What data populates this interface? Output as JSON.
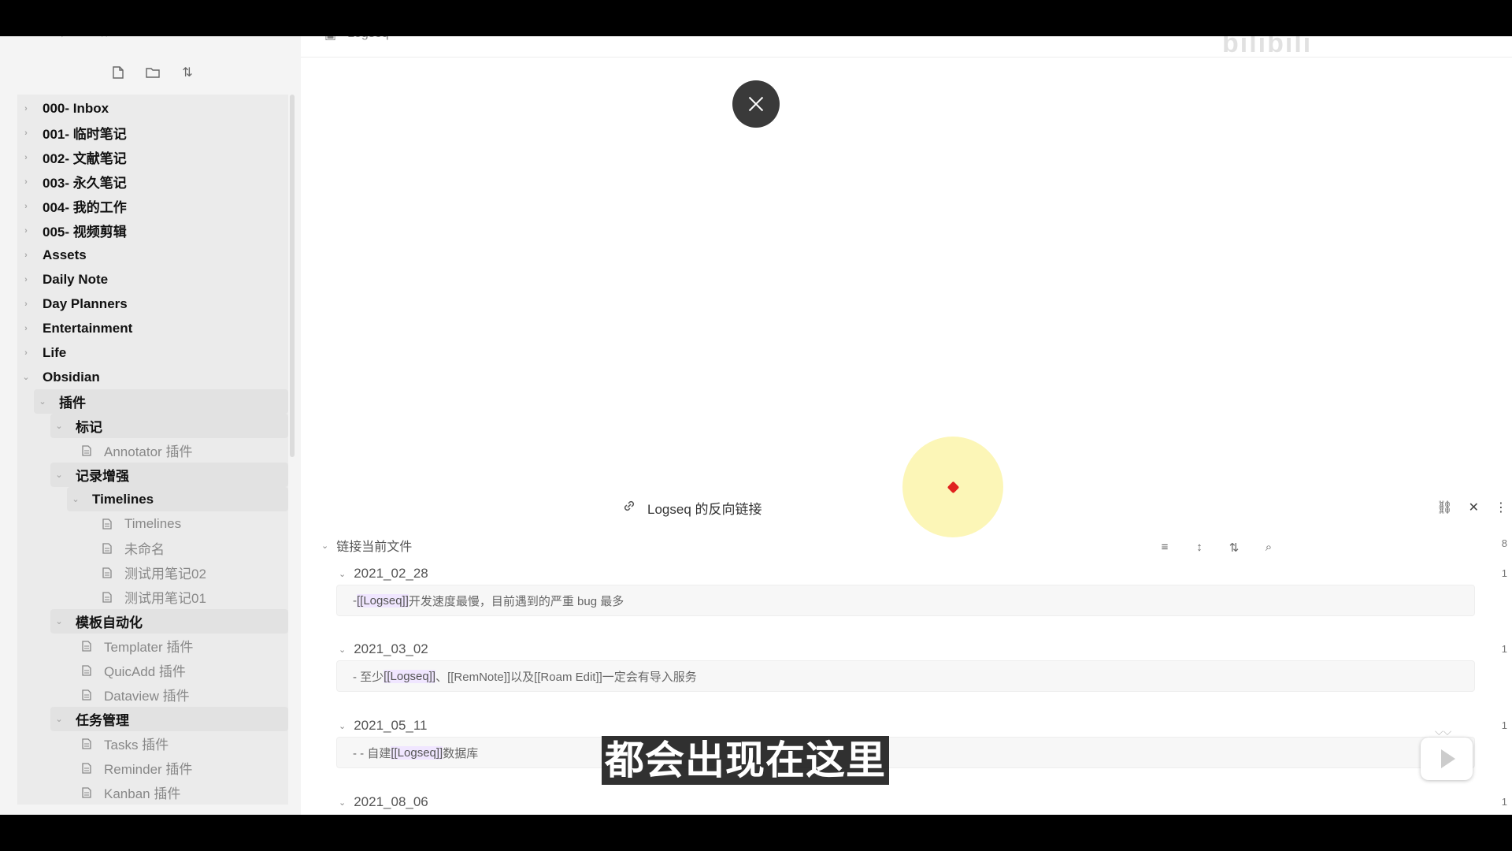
{
  "sidebar": {
    "toolbar": [
      "new-note-icon",
      "new-folder-icon",
      "sort-icon"
    ],
    "tree": [
      {
        "label": "000- Inbox",
        "type": "folder",
        "level": 0,
        "open": false
      },
      {
        "label": "001- 临时笔记",
        "type": "folder",
        "level": 0,
        "open": false
      },
      {
        "label": "002- 文献笔记",
        "type": "folder",
        "level": 0,
        "open": false
      },
      {
        "label": "003- 永久笔记",
        "type": "folder",
        "level": 0,
        "open": false
      },
      {
        "label": "004- 我的工作",
        "type": "folder",
        "level": 0,
        "open": false
      },
      {
        "label": "005- 视频剪辑",
        "type": "folder",
        "level": 0,
        "open": false
      },
      {
        "label": "Assets",
        "type": "folder",
        "level": 0,
        "open": false
      },
      {
        "label": "Daily Note",
        "type": "folder",
        "level": 0,
        "open": false
      },
      {
        "label": "Day Planners",
        "type": "folder",
        "level": 0,
        "open": false
      },
      {
        "label": "Entertainment",
        "type": "folder",
        "level": 0,
        "open": false
      },
      {
        "label": "Life",
        "type": "folder",
        "level": 0,
        "open": false
      },
      {
        "label": "Obsidian",
        "type": "folder",
        "level": 0,
        "open": true
      },
      {
        "label": "插件",
        "type": "folder",
        "level": 1,
        "open": true
      },
      {
        "label": "标记",
        "type": "folder",
        "level": 2,
        "open": true
      },
      {
        "label": "Annotator 插件",
        "type": "file",
        "level": 3
      },
      {
        "label": "记录增强",
        "type": "folder",
        "level": 2,
        "open": true
      },
      {
        "label": "Timelines",
        "type": "folder",
        "level": 3,
        "open": true
      },
      {
        "label": "Timelines",
        "type": "file",
        "level": 4
      },
      {
        "label": "未命名",
        "type": "file",
        "level": 4
      },
      {
        "label": "测试用笔记02",
        "type": "file",
        "level": 4
      },
      {
        "label": "测试用笔记01",
        "type": "file",
        "level": 4
      },
      {
        "label": "模板自动化",
        "type": "folder",
        "level": 2,
        "open": true
      },
      {
        "label": "Templater 插件",
        "type": "file",
        "level": 3
      },
      {
        "label": "QuicAdd 插件",
        "type": "file",
        "level": 3
      },
      {
        "label": "Dataview 插件",
        "type": "file",
        "level": 3
      },
      {
        "label": "任务管理",
        "type": "folder",
        "level": 2,
        "open": true
      },
      {
        "label": "Tasks 插件",
        "type": "file",
        "level": 3
      },
      {
        "label": "Reminder 插件",
        "type": "file",
        "level": 3
      },
      {
        "label": "Kanban 插件",
        "type": "file",
        "level": 3
      }
    ]
  },
  "main": {
    "tab_title": "Logseq",
    "watermark": "bilibili"
  },
  "backlinks": {
    "title": "Logseq 的反向链接",
    "group_label": "链接当前文件",
    "group_count": "8",
    "entries": [
      {
        "date": "2021_02_28",
        "count": "1",
        "prefix": "- ",
        "link": "[[Logseq]]",
        "text": " 开发速度最慢，目前遇到的严重 bug 最多"
      },
      {
        "date": "2021_03_02",
        "count": "1",
        "prefix": "- 至少 ",
        "link": "[[Logseq]]",
        "text": "、[[RemNote]]以及[[Roam Edit]]一定会有导入服务"
      },
      {
        "date": "2021_05_11",
        "count": "1",
        "prefix": "- - 自建 ",
        "link": "[[Logseq]]",
        "text": " 数据库"
      },
      {
        "date": "2021_08_06",
        "count": "1",
        "prefix": "",
        "link": "",
        "text": ""
      }
    ]
  },
  "subtitle": "都会出现在这里"
}
